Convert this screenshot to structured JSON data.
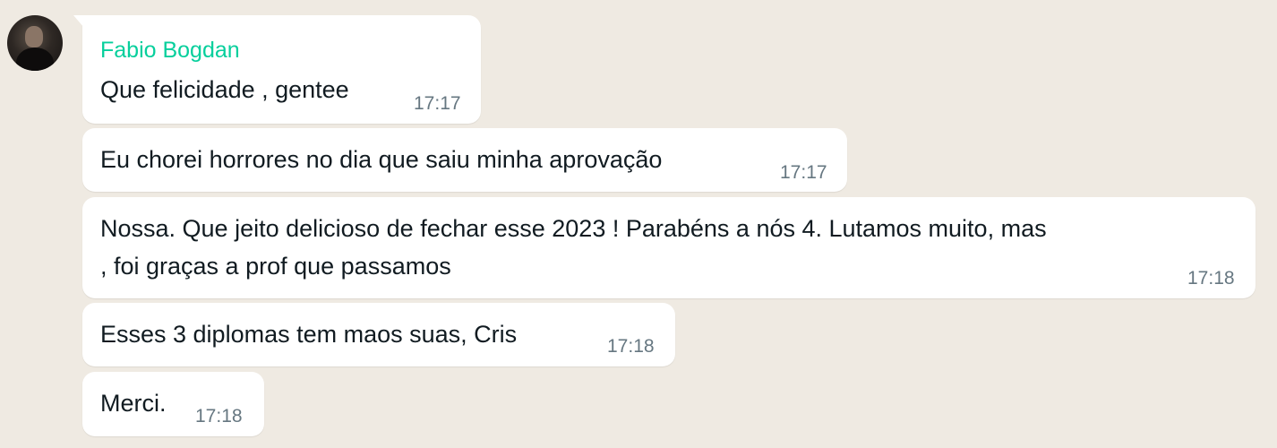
{
  "colors": {
    "background": "#efeae2",
    "bubble": "#ffffff",
    "sender_name": "#06cf9c",
    "message_text": "#111b21",
    "timestamp": "#667781"
  },
  "sender": {
    "name": "Fabio Bogdan",
    "avatar_icon": "profile-photo"
  },
  "messages": [
    {
      "text": "Que felicidade , gentee",
      "time": "17:17"
    },
    {
      "text": "Eu chorei horrores no dia que saiu minha aprovação",
      "time": "17:17"
    },
    {
      "text_line1": "Nossa. Que jeito delicioso de fechar esse 2023 ! Parabéns a nós 4. Lutamos muito, mas",
      "text_line2": ", foi graças a prof que passamos",
      "time": "17:18"
    },
    {
      "text": "Esses 3 diplomas tem maos suas, Cris",
      "time": "17:18"
    },
    {
      "text": "Merci.",
      "time": "17:18"
    }
  ]
}
